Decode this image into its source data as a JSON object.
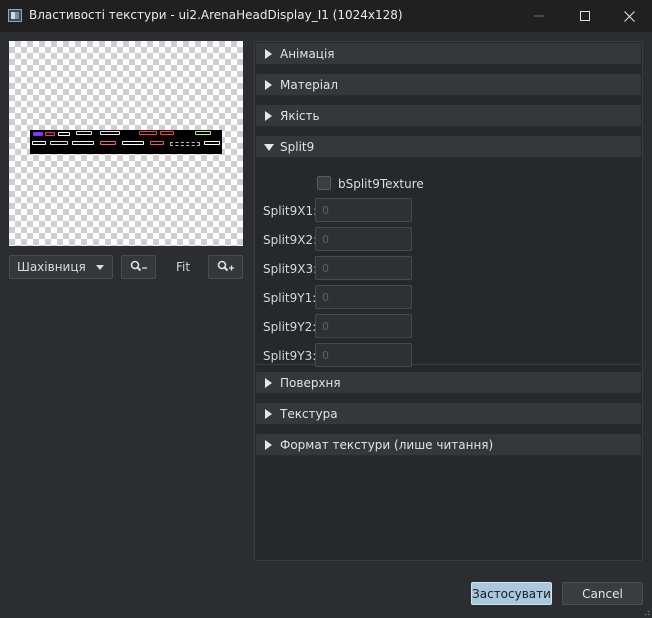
{
  "window": {
    "title": "Властивості текстури - ui2.ArenaHeadDisplay_I1 (1024x128)",
    "minimize_icon": "minimize-icon",
    "maximize_icon": "maximize-icon",
    "close_icon": "close-icon"
  },
  "preview": {
    "background_mode": "Шахівниця",
    "zoom_out_icon": "zoom-out-icon",
    "zoom_in_icon": "zoom-in-icon",
    "fit_label": "Fit"
  },
  "sections": [
    {
      "label": "Анімація",
      "expanded": false
    },
    {
      "label": "Матеріал",
      "expanded": false
    },
    {
      "label": "Якість",
      "expanded": false
    },
    {
      "label": "Split9",
      "expanded": true
    },
    {
      "label": "Поверхня",
      "expanded": false
    },
    {
      "label": "Текстура",
      "expanded": false
    },
    {
      "label": "Формат текстури (лише читання)",
      "expanded": false
    }
  ],
  "split9": {
    "checkbox_label": "bSplit9Texture",
    "checkbox_checked": false,
    "fields": [
      {
        "label": "Split9X1:",
        "placeholder": "0"
      },
      {
        "label": "Split9X2:",
        "placeholder": "0"
      },
      {
        "label": "Split9X3:",
        "placeholder": "0"
      },
      {
        "label": "Split9Y1:",
        "placeholder": "0"
      },
      {
        "label": "Split9Y2:",
        "placeholder": "0"
      },
      {
        "label": "Split9Y3:",
        "placeholder": "0"
      }
    ]
  },
  "buttons": {
    "apply": "Застосувати",
    "cancel": "Cancel"
  },
  "colors": {
    "accent_button": "#a9c8e0",
    "background": "#2b2d30"
  }
}
